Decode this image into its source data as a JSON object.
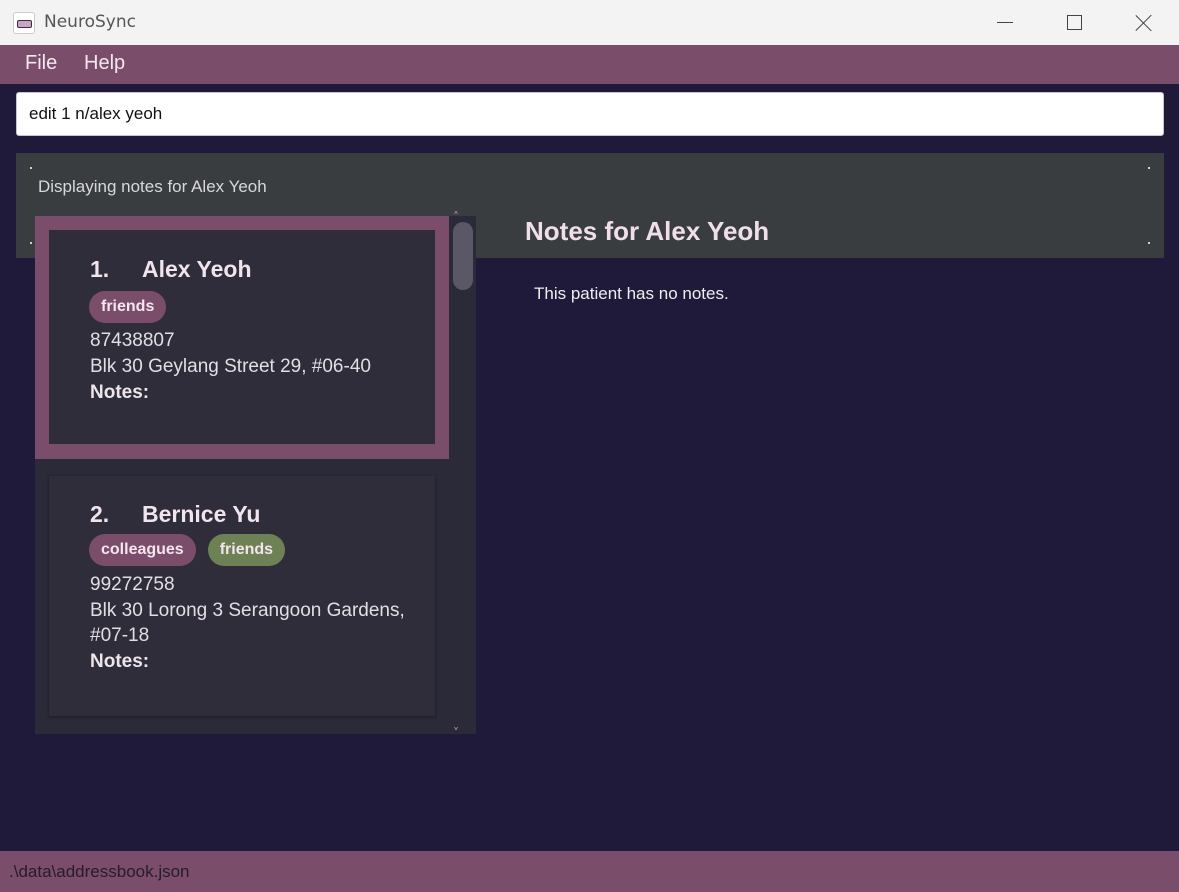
{
  "window": {
    "title": "NeuroSync"
  },
  "menu": {
    "file": "File",
    "help": "Help"
  },
  "command": {
    "value": "edit 1 n/alex yeoh"
  },
  "result": {
    "message": "Displaying notes for Alex Yeoh"
  },
  "patients": [
    {
      "index": "1.",
      "name": "Alex Yeoh",
      "tags": [
        {
          "label": "friends",
          "color": "#7a4d6a"
        }
      ],
      "phone": "87438807",
      "address_line1": "Blk 30 Geylang Street 29, #06-40",
      "address_line2": "",
      "notes_label": "Notes:"
    },
    {
      "index": "2.",
      "name": "Bernice Yu",
      "tags": [
        {
          "label": "colleagues",
          "color": "#7a4d6a"
        },
        {
          "label": "friends",
          "color": "#6d8155"
        }
      ],
      "phone": "99272758",
      "address_line1": "Blk 30 Lorong 3 Serangoon Gardens,",
      "address_line2": "#07-18",
      "notes_label": "Notes:"
    }
  ],
  "notes_panel": {
    "title": "Notes for Alex Yeoh",
    "empty_message": "This patient has no notes."
  },
  "status": {
    "path": ".\\data\\addressbook.json"
  },
  "scroll": {
    "up_glyph": "˄",
    "down_glyph": "˅"
  },
  "colors": {
    "accent": "#7a4d6a",
    "background": "#1f1a3a",
    "card": "#2e2d39",
    "tag_green": "#6d8155"
  }
}
